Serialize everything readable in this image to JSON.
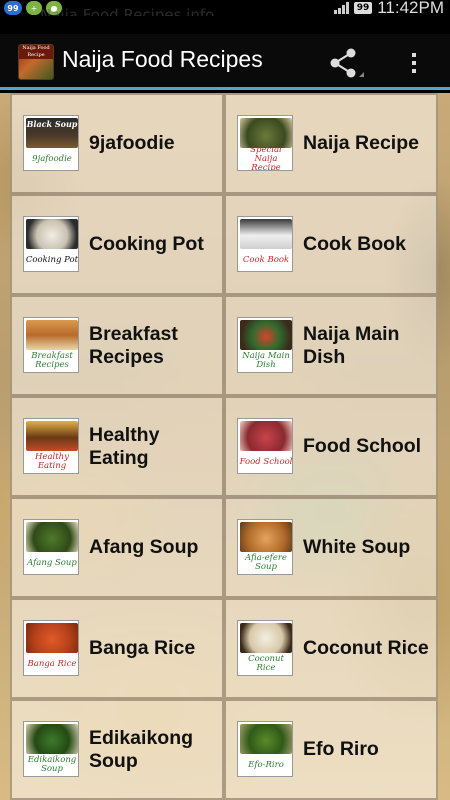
{
  "status_bar": {
    "notification_badge": "99",
    "notification_ghost_text": "Naija Food Recipes info",
    "battery": "99",
    "time": "11:42PM"
  },
  "action_bar": {
    "app_icon_text": "Naija Food Recipe",
    "title": "Naija Food Recipes",
    "share_icon": "share-icon",
    "overflow_icon": "overflow-menu-icon"
  },
  "colors": {
    "accent": "#4fa9cf",
    "caption_green": "#2e7d32",
    "caption_red": "#c62828"
  },
  "tiles": [
    {
      "label": "9jafoodie",
      "caption": "9jafoodie",
      "thumb_heading": "Black Soup",
      "caption_color": "green",
      "photo": "black-soup"
    },
    {
      "label": "Naija Recipe",
      "caption": "Special Naija Recipe",
      "caption_color": "red",
      "photo": "naija-recipe"
    },
    {
      "label": "Cooking Pot",
      "caption": "Cooking Pot",
      "caption_color": "black",
      "photo": "cooking-pot"
    },
    {
      "label": "Cook Book",
      "caption": "Cook Book",
      "caption_color": "red",
      "photo": "cook-book"
    },
    {
      "label": "Breakfast Recipes",
      "caption": "Breakfast Recipes",
      "caption_color": "green",
      "photo": "breakfast"
    },
    {
      "label": "Naija Main Dish",
      "caption": "Naija Main Dish",
      "caption_color": "green",
      "photo": "main-dish"
    },
    {
      "label": "Healthy Eating",
      "caption": "Healthy Eating",
      "caption_color": "red",
      "photo": "healthy"
    },
    {
      "label": "Food School",
      "caption": "Food School",
      "caption_color": "red",
      "photo": "food-school"
    },
    {
      "label": "Afang Soup",
      "caption": "Afang Soup",
      "caption_color": "green",
      "photo": "afang"
    },
    {
      "label": "White Soup",
      "caption": "Afia-efere Soup",
      "caption_color": "green",
      "photo": "white-soup"
    },
    {
      "label": "Banga Rice",
      "caption": "Banga Rice",
      "caption_color": "red",
      "photo": "banga"
    },
    {
      "label": "Coconut Rice",
      "caption": "Coconut Rice",
      "caption_color": "green",
      "photo": "coconut"
    },
    {
      "label": "Edikaikong Soup",
      "caption": "Edikaikong Soup",
      "caption_color": "green",
      "photo": "edikaikong"
    },
    {
      "label": "Efo Riro",
      "caption": "Efo-Riro",
      "caption_color": "green",
      "photo": "efo-riro"
    }
  ]
}
